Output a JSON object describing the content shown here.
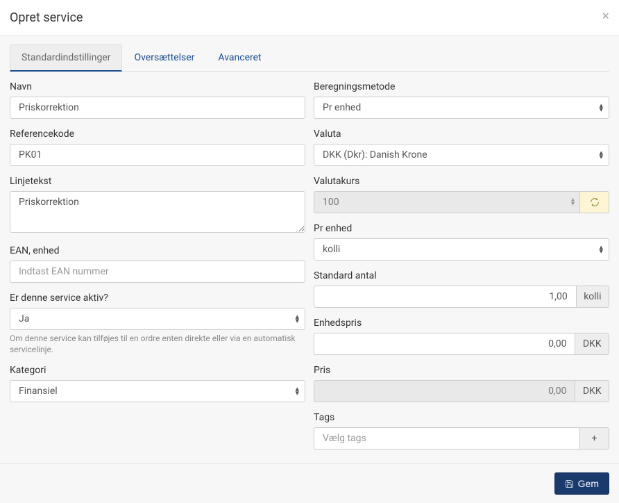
{
  "header": {
    "title": "Opret service",
    "close": "×"
  },
  "tabs": {
    "standard": "Standardindstillinger",
    "translations": "Oversættelser",
    "advanced": "Avanceret"
  },
  "left": {
    "name": {
      "label": "Navn",
      "value": "Priskorrektion"
    },
    "refcode": {
      "label": "Referencekode",
      "value": "PK01"
    },
    "linetext": {
      "label": "Linjetekst",
      "value": "Priskorrektion"
    },
    "ean": {
      "label": "EAN, enhed",
      "placeholder": "Indtast EAN nummer"
    },
    "active": {
      "label": "Er denne service aktiv?",
      "value": "Ja",
      "help": "Om denne service kan tilføjes til en ordre enten direkte eller via en automatisk servicelinje."
    },
    "category": {
      "label": "Kategori",
      "value": "Finansiel"
    }
  },
  "right": {
    "calcmethod": {
      "label": "Beregningsmetode",
      "value": "Pr enhed"
    },
    "currency": {
      "label": "Valuta",
      "value": "DKK (Dkr): Danish Krone"
    },
    "rate": {
      "label": "Valutakurs",
      "value": "100"
    },
    "perunit": {
      "label": "Pr enhed",
      "value": "kolli"
    },
    "stdqty": {
      "label": "Standard antal",
      "value": "1,00",
      "suffix": "kolli"
    },
    "unitprice": {
      "label": "Enhedspris",
      "value": "0,00",
      "suffix": "DKK"
    },
    "price": {
      "label": "Pris",
      "value": "0,00",
      "suffix": "DKK"
    },
    "tags": {
      "label": "Tags",
      "placeholder": "Vælg tags",
      "add": "+"
    }
  },
  "footer": {
    "save": "Gem"
  }
}
